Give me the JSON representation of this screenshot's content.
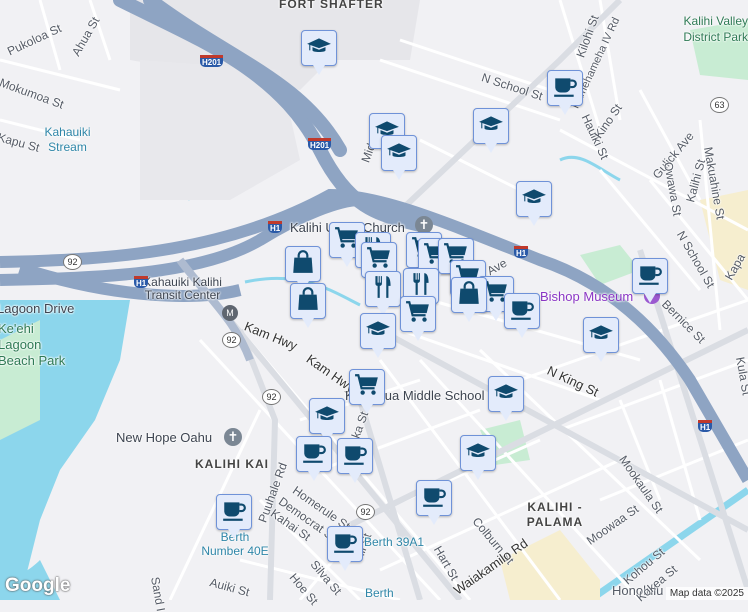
{
  "map": {
    "areas": {
      "fort_shafter": "FORT SHAFTER",
      "kalihi_kai": "KALIHI KAI",
      "kalihi_palama": "KALIHI - PALAMA",
      "honolulu": "Honolulu"
    },
    "streets": {
      "pukoloa": "Pukoloa St",
      "ahua": "Ahua St",
      "mokumoa": "Mokumoa St",
      "kapu": "Kapu St",
      "n_school_1": "N School St",
      "kilohi": "Kilohi St",
      "kamehameha_iv": "Kamehameha IV Rd",
      "hauiki": "Hauiki St",
      "kino": "Kino St",
      "gulick": "Gulick Ave",
      "owawa": "Owawa St",
      "makuahine": "Makuahine St",
      "n_school_2": "N School St",
      "kapalama": "Kapa",
      "bernice": "Bernice St",
      "kalihi_st": "Kalihi St",
      "kula": "Kula St",
      "middle": "Mid",
      "kam_hwy_1": "Kam Hwy",
      "kam_hwy_2": "Kam Hwy",
      "n_king": "N King St",
      "puuhale": "Puuhale Rd",
      "homerule": "Homerule St",
      "democrat": "Democrat St",
      "kahai": "Kahai St",
      "mookaula": "Mookaula St",
      "moowaa": "Moowaa St",
      "colburn": "Colburn St",
      "waiakamilo": "Waiakamilo Rd",
      "hart": "Hart St",
      "silva": "Silva St",
      "hoe": "Hoe St",
      "auiki": "Auiki St",
      "sand_island": "Sand I",
      "kohou": "Kohou St",
      "kokea": "Kokea St",
      "ave": "Ave",
      "eka": "eka St",
      "ill": "ill St"
    },
    "pois": {
      "kalihi_valley_park": "Kalihi Valley District Park",
      "kahauiki_stream": "Kahauiki Stream",
      "kalihi_church": "Kalihi Union Church",
      "bishop_museum": "Bishop Museum",
      "transit_center": "Kahauiki Kalihi Transit Center",
      "lagoon_drive": "Lagoon Drive",
      "keehi_park": "Ke'ehi Lagoon Beach Park",
      "kalakaua_school": "Kalakaua Middle School",
      "new_hope": "New Hope Oahu",
      "berth_39a1": "Berth 39A1",
      "berth_40e": "Berth Number 40E",
      "berth": "Berth"
    },
    "shields": {
      "h201_a": "H201",
      "h201_b": "H201",
      "h1_a": "H1",
      "h1_b": "H1",
      "h1_c": "H1",
      "h1_d": "H1",
      "r92_a": "92",
      "r92_b": "92",
      "r92_c": "92",
      "r92_d": "92",
      "r63": "63",
      "metro": "M"
    },
    "markers": [
      {
        "icon": "school-icon"
      },
      {
        "icon": "school-icon"
      },
      {
        "icon": "school-icon"
      },
      {
        "icon": "cafe-icon"
      },
      {
        "icon": "school-icon"
      },
      {
        "icon": "school-icon"
      },
      {
        "icon": "cafe-icon"
      },
      {
        "icon": "school-icon"
      },
      {
        "icon": "shopping-cart-icon"
      },
      {
        "icon": "restaurant-icon"
      },
      {
        "icon": "shopping-cart-icon"
      },
      {
        "icon": "shopping-cart-icon"
      },
      {
        "icon": "shopping-cart-icon"
      },
      {
        "icon": "shopping-cart-icon"
      },
      {
        "icon": "shopping-cart-icon"
      },
      {
        "icon": "shopping-cart-icon"
      },
      {
        "icon": "restaurant-icon"
      },
      {
        "icon": "restaurant-icon"
      },
      {
        "icon": "shopping-bag-icon"
      },
      {
        "icon": "shopping-bag-icon"
      },
      {
        "icon": "shopping-bag-icon"
      },
      {
        "icon": "cafe-icon"
      },
      {
        "icon": "shopping-cart-icon"
      },
      {
        "icon": "school-icon"
      },
      {
        "icon": "shopping-cart-icon"
      },
      {
        "icon": "school-icon"
      },
      {
        "icon": "school-icon"
      },
      {
        "icon": "cafe-icon"
      },
      {
        "icon": "cafe-icon"
      },
      {
        "icon": "school-icon"
      },
      {
        "icon": "cafe-icon"
      },
      {
        "icon": "cafe-icon"
      },
      {
        "icon": "cafe-icon"
      }
    ],
    "colors": {
      "marker_icon": "#0f4a6e",
      "highway": "#8ea4c3",
      "water": "#8cd6ec",
      "park": "#c8ecd3"
    }
  },
  "attribution": {
    "logo": "Google",
    "map_data": "Map data ©2025"
  }
}
